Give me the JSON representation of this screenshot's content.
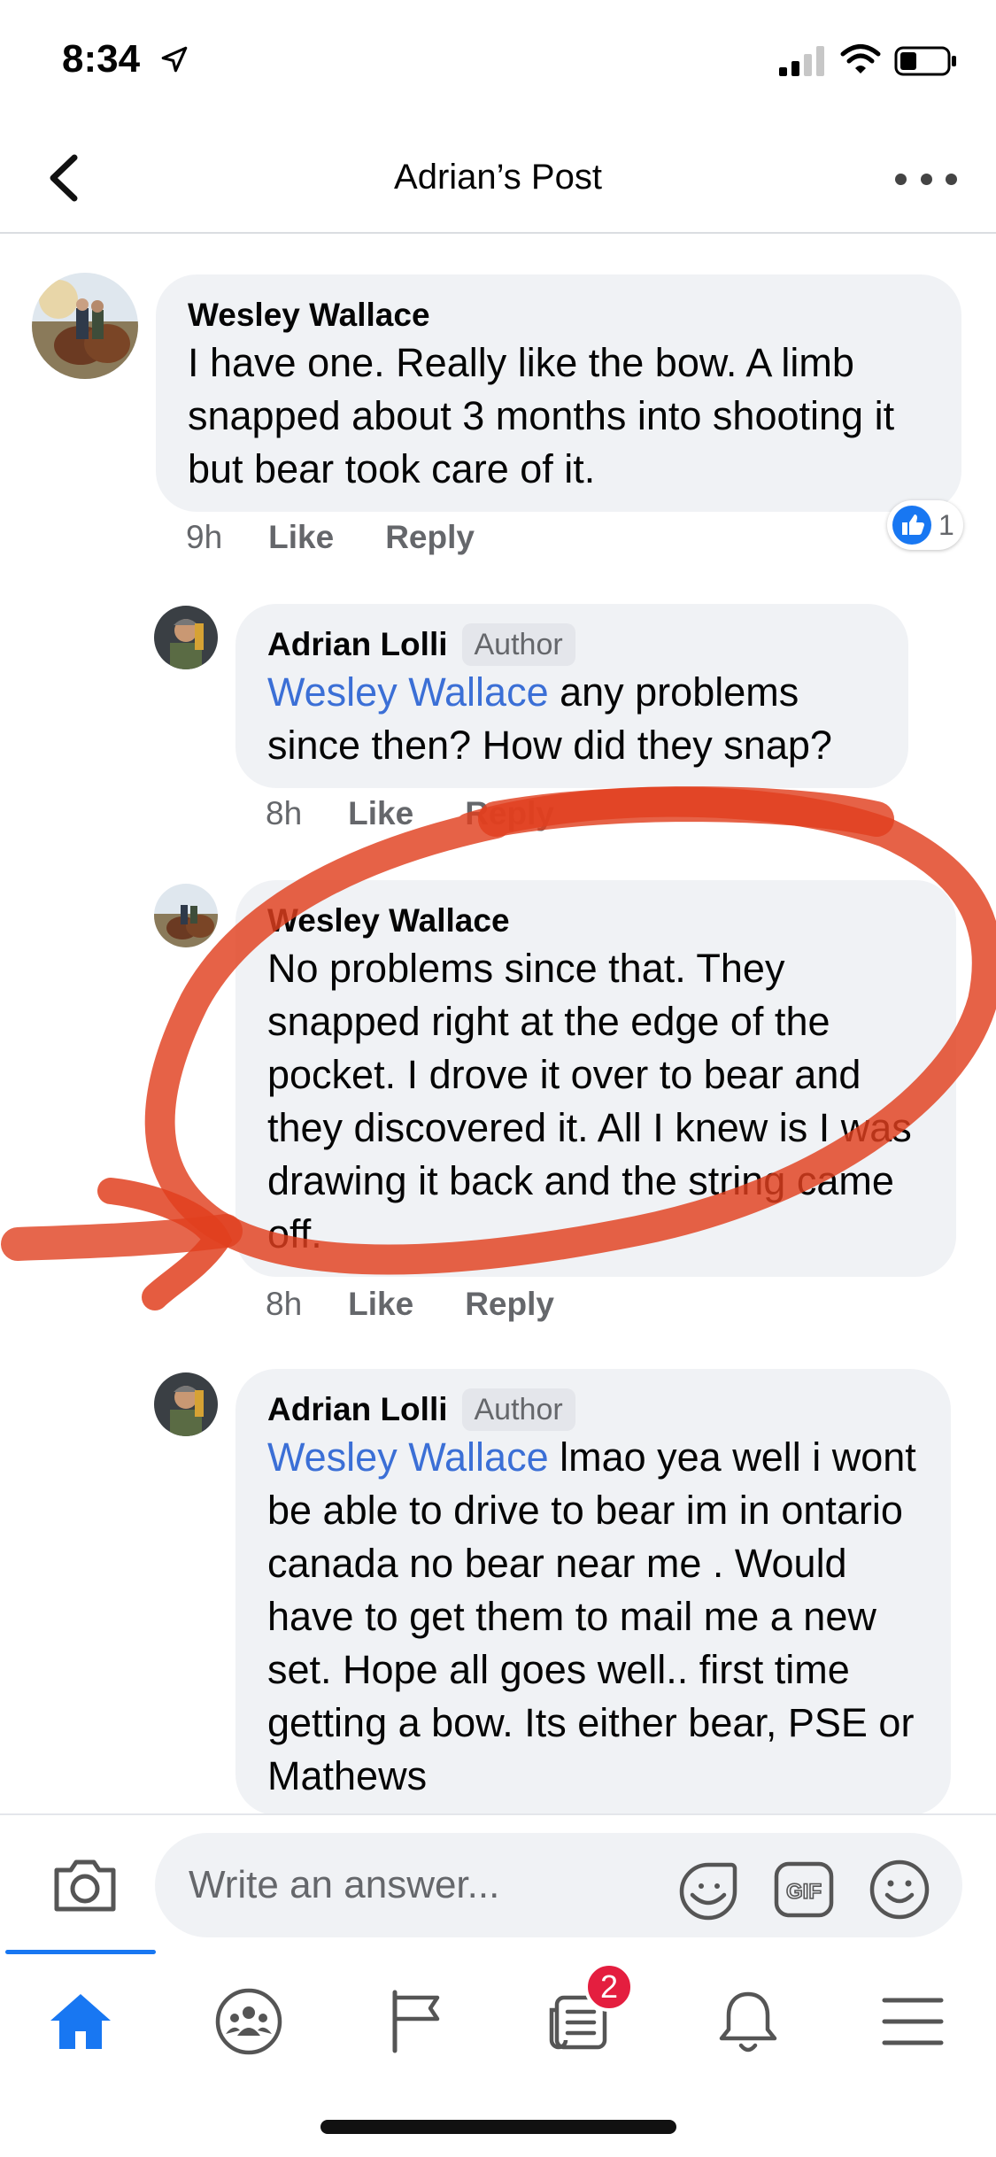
{
  "status_bar": {
    "time": "8:34"
  },
  "header": {
    "title": "Adrian’s Post"
  },
  "comments": [
    {
      "author": "Wesley Wallace",
      "badge": "",
      "mention": "",
      "text": "I have one. Really like the bow. A limb snapped about 3 months into shooting it but bear took care of it.",
      "time": "9h",
      "like_label": "Like",
      "reply_label": "Reply",
      "reaction_count": "1"
    },
    {
      "author": "Adrian Lolli",
      "badge": "Author",
      "mention": "Wesley Wallace",
      "text": " any problems since then? How did they snap?",
      "time": "8h",
      "like_label": "Like",
      "reply_label": "Reply"
    },
    {
      "author": "Wesley Wallace",
      "badge": "",
      "mention": "",
      "text": "No problems since that. They snapped right at the edge of the pocket. I drove it over to bear and they discovered it. All I knew is I was drawing it back and the string came off.",
      "time": "8h",
      "like_label": "Like",
      "reply_label": "Reply"
    },
    {
      "author": "Adrian Lolli",
      "badge": "Author",
      "mention": "Wesley Wallace",
      "text": " lmao yea well i wont be able to drive to bear im in ontario canada no bear near me . Would have to get them to mail me a new set. Hope all goes well.. first time getting a bow. Its either bear, PSE or Mathews"
    }
  ],
  "composer": {
    "placeholder": "Write an answer...",
    "gif_label": "GIF"
  },
  "tab_bar": {
    "notifications_badge": "2"
  },
  "colors": {
    "accent": "#1877f2",
    "mention": "#3b6fd6",
    "annotation": "#e0401f",
    "badge": "#e41e3f"
  }
}
